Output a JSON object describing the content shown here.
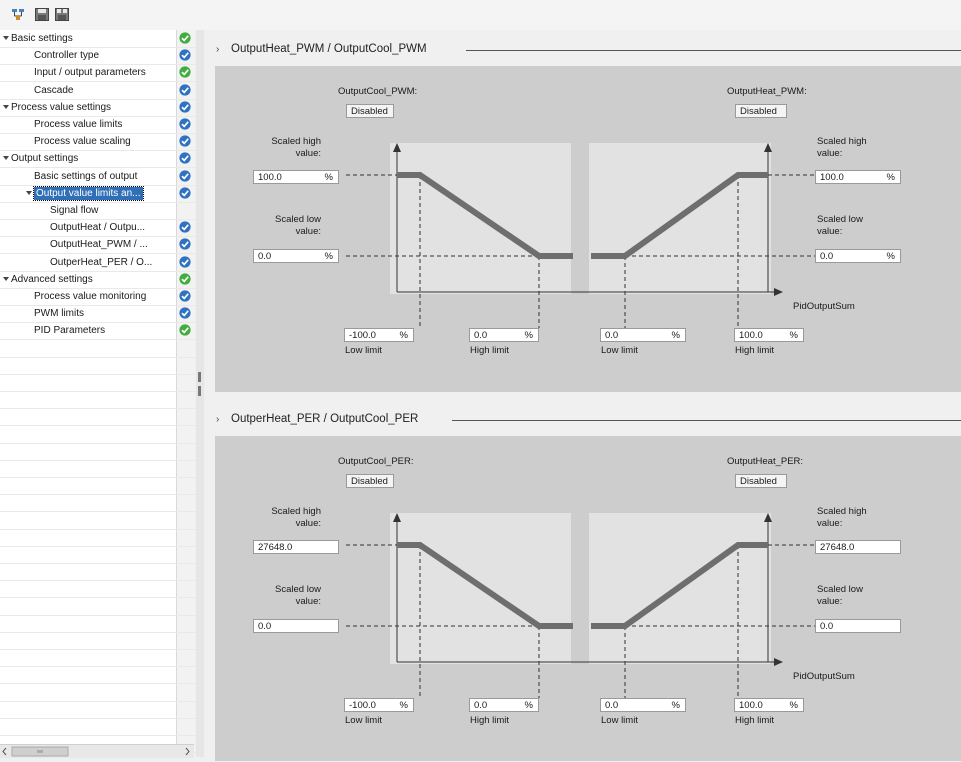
{
  "toolbar": {
    "buttons": [
      "functional-view-icon",
      "save-icon",
      "save-all-icon"
    ]
  },
  "nav": {
    "items": [
      {
        "label": "Basic settings",
        "expand": true,
        "status": "green"
      },
      {
        "label": "Controller type",
        "status": "blue"
      },
      {
        "label": "Input / output parameters",
        "status": "green"
      },
      {
        "label": "Cascade",
        "status": "blue"
      },
      {
        "label": "Process value settings",
        "expand": true,
        "status": "blue"
      },
      {
        "label": "Process value limits",
        "status": "blue"
      },
      {
        "label": "Process value scaling",
        "status": "blue"
      },
      {
        "label": "Output settings",
        "expand": true,
        "status": "blue"
      },
      {
        "label": "Basic settings of output",
        "status": "blue"
      },
      {
        "label": "Output value limits an...",
        "expand": true,
        "selected": true,
        "status": "blue"
      },
      {
        "label": "Signal flow",
        "status": ""
      },
      {
        "label": "OutputHeat / Outpu...",
        "status": "blue"
      },
      {
        "label": "OutputHeat_PWM / ...",
        "status": "blue"
      },
      {
        "label": "OutperHeat_PER / O...",
        "status": "blue"
      },
      {
        "label": "Advanced settings",
        "expand": true,
        "status": "green"
      },
      {
        "label": "Process value monitoring",
        "status": "blue"
      },
      {
        "label": "PWM limits",
        "status": "blue"
      },
      {
        "label": "PID Parameters",
        "status": "green"
      }
    ]
  },
  "colors": {
    "green": "#3fae3f",
    "blue": "#2f72c4",
    "selection": "#2f6fb8",
    "curve": "#6e6e6e"
  },
  "sections": [
    {
      "title": "OutputHeat_PWM / OutputCool_PWM",
      "cool_label": "OutputCool_PWM:",
      "cool_value": "Disabled",
      "heat_label": "OutputHeat_PWM:",
      "heat_value": "Disabled",
      "scaled_high_label": "Scaled high value:",
      "scaled_low_label": "Scaled low value:",
      "left_high": "100.0",
      "left_high_unit": "%",
      "left_low": "0.0",
      "left_low_unit": "%",
      "right_high": "100.0",
      "right_high_unit": "%",
      "right_low": "0.0",
      "right_low_unit": "%",
      "axis_label": "PidOutputSum",
      "limits": [
        {
          "value": "-100.0",
          "unit": "%",
          "label": "Low limit"
        },
        {
          "value": "0.0",
          "unit": "%",
          "label": "High limit"
        },
        {
          "value": "0.0",
          "unit": "%",
          "label": "Low limit"
        },
        {
          "value": "100.0",
          "unit": "%",
          "label": "High limit"
        }
      ]
    },
    {
      "title": "OutperHeat_PER / OutputCool_PER",
      "cool_label": "OutputCool_PER:",
      "cool_value": "Disabled",
      "heat_label": "OutputHeat_PER:",
      "heat_value": "Disabled",
      "scaled_high_label": "Scaled high value:",
      "scaled_low_label": "Scaled low value:",
      "left_high": "27648.0",
      "left_high_unit": "",
      "left_low": "0.0",
      "left_low_unit": "",
      "right_high": "27648.0",
      "right_high_unit": "",
      "right_low": "0.0",
      "right_low_unit": "",
      "axis_label": "PidOutputSum",
      "limits": [
        {
          "value": "-100.0",
          "unit": "%",
          "label": "Low limit"
        },
        {
          "value": "0.0",
          "unit": "%",
          "label": "High limit"
        },
        {
          "value": "0.0",
          "unit": "%",
          "label": "Low limit"
        },
        {
          "value": "100.0",
          "unit": "%",
          "label": "High limit"
        }
      ]
    }
  ]
}
